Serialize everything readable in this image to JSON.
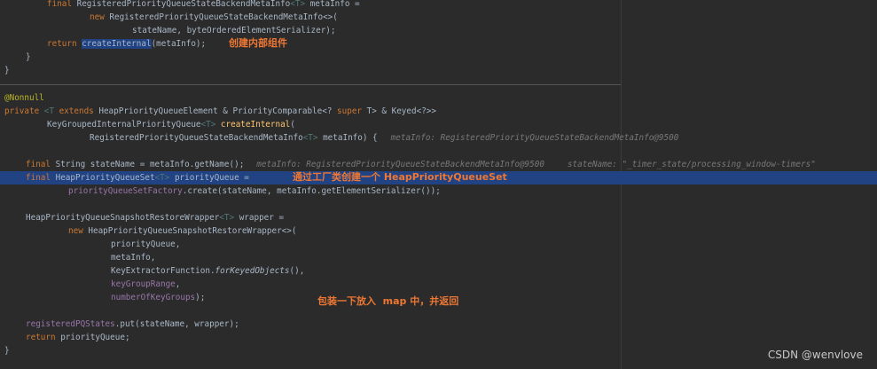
{
  "code": {
    "l1": {
      "a": "final ",
      "b": "RegisteredPriorityQueueStateBackendMetaInfo",
      "c": "<T>",
      "d": " metaInfo ="
    },
    "l2": {
      "a": "new ",
      "b": "RegisteredPriorityQueueStateBackendMetaInfo<>("
    },
    "l3": {
      "a": "stateName, byteOrderedElementSerializer);"
    },
    "l4": {
      "a": "return ",
      "b": "createInternal",
      "c": "(metaInfo);"
    },
    "l5": {
      "a": "}"
    },
    "l6": {
      "a": "}"
    },
    "l7": {
      "a": "@Nonnull"
    },
    "l8": {
      "a": "private ",
      "b": "<T ",
      "c": "extends",
      "d": " HeapPriorityQueueElement & PriorityComparable<? ",
      "e": "super",
      "f": " T> & Keyed<?>>"
    },
    "l9": {
      "a": "KeyGroupedInternalPriorityQueue",
      "b": "<T>",
      "c": " ",
      "d": "createInternal",
      "e": "("
    },
    "l10": {
      "a": "RegisteredPriorityQueueStateBackendMetaInfo",
      "b": "<T>",
      "c": " metaInfo) {",
      "hint": "metaInfo: RegisteredPriorityQueueStateBackendMetaInfo@9500"
    },
    "l11": {
      "a": "final ",
      "b": "String stateName = metaInfo.getName();",
      "hint1": "metaInfo: RegisteredPriorityQueueStateBackendMetaInfo@9500",
      "hint2": "stateName: \"_timer_state/processing_window-timers\""
    },
    "l12": {
      "a": "final ",
      "b": "HeapPriorityQueueSet",
      "c": "<T>",
      "d": " priorityQueue ="
    },
    "l13": {
      "a": "priorityQueueSetFactory",
      "b": ".create(stateName, metaInfo.getElementSerializer());"
    },
    "l14": {
      "a": "HeapPriorityQueueSnapshotRestoreWrapper",
      "b": "<T>",
      "c": " wrapper ="
    },
    "l15": {
      "a": "new ",
      "b": "HeapPriorityQueueSnapshotRestoreWrapper<>("
    },
    "l16": {
      "a": "priorityQueue,"
    },
    "l17": {
      "a": "metaInfo,"
    },
    "l18": {
      "a": "KeyExtractorFunction.",
      "b": "forKeyedObjects",
      "c": "(),"
    },
    "l19": {
      "a": "keyGroupRange",
      "b": ","
    },
    "l20": {
      "a": "numberOfKeyGroups",
      "b": ");"
    },
    "l21": {
      "a": "registeredPQStates",
      "b": ".put(stateName, wrapper);"
    },
    "l22": {
      "a": "return ",
      "b": "priorityQueue;"
    },
    "l23": {
      "a": "}"
    }
  },
  "notes": {
    "n1": "创建内部组件",
    "n2": "通过工厂类创建一个 HeapPriorityQueueSet",
    "n3": "包装一下放入  map 中，并返回"
  },
  "watermark": "CSDN @wenvlove",
  "colors": {
    "background": "#2b2b2b",
    "keyword": "#cc7832",
    "default_text": "#a9b7c6",
    "method": "#ffc66d",
    "field": "#9876aa",
    "annotation": "#bbb529",
    "selection": "#214283",
    "note": "#ee7733",
    "inline_hint": "#787878"
  }
}
